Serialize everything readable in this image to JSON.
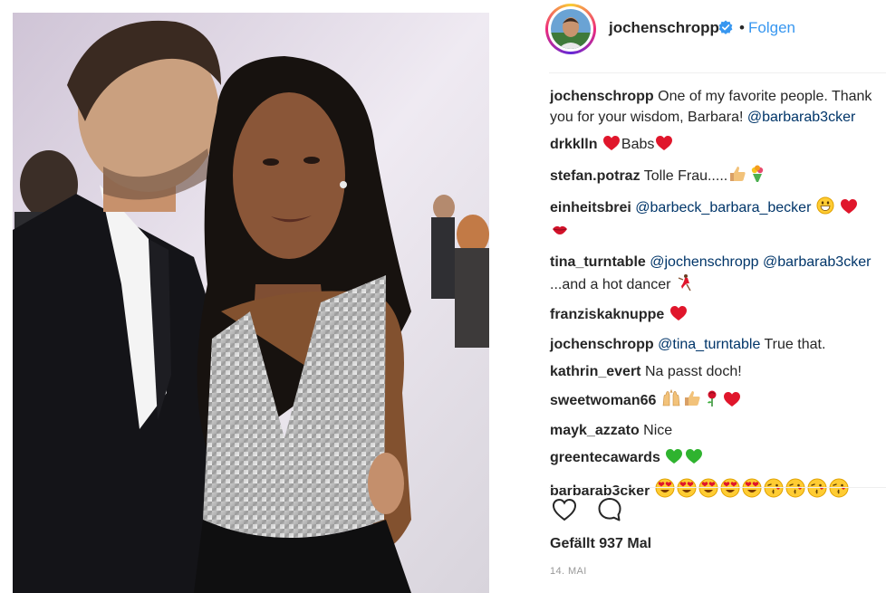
{
  "post": {
    "author": "jochenschropp",
    "separator": "•",
    "follow_label": "Folgen",
    "likes_text": "Gefällt 937 Mal",
    "date": "14. MAI"
  },
  "comments": [
    {
      "user": "jochenschropp",
      "parts": [
        {
          "t": "text",
          "v": " One of my favorite people. Thank you for your wisdom, Barbara! "
        },
        {
          "t": "mention",
          "v": "@barbarab3cker"
        }
      ]
    },
    {
      "user": "drkklln",
      "parts": [
        {
          "t": "text",
          "v": " "
        },
        {
          "t": "emoji",
          "v": "heart"
        },
        {
          "t": "text",
          "v": "Babs"
        },
        {
          "t": "emoji",
          "v": "heart"
        }
      ]
    },
    {
      "user": "stefan.potraz",
      "parts": [
        {
          "t": "text",
          "v": " Tolle Frau....."
        },
        {
          "t": "emoji",
          "v": "thumbs-up"
        },
        {
          "t": "emoji",
          "v": "bouquet"
        }
      ]
    },
    {
      "user": "einheitsbrei",
      "parts": [
        {
          "t": "text",
          "v": " "
        },
        {
          "t": "mention",
          "v": "@barbeck_barbara_becker"
        },
        {
          "t": "text",
          "v": " "
        },
        {
          "t": "emoji",
          "v": "grin"
        },
        {
          "t": "text",
          "v": " "
        },
        {
          "t": "emoji",
          "v": "heart"
        },
        {
          "t": "emoji",
          "v": "kiss"
        }
      ]
    },
    {
      "user": "tina_turntable",
      "parts": [
        {
          "t": "text",
          "v": " "
        },
        {
          "t": "mention",
          "v": "@jochenschropp"
        },
        {
          "t": "text",
          "v": " "
        },
        {
          "t": "mention",
          "v": "@barbarab3cker"
        },
        {
          "t": "text",
          "v": " ...and a hot dancer "
        },
        {
          "t": "emoji",
          "v": "dancer"
        }
      ]
    },
    {
      "user": "franziskaknuppe",
      "parts": [
        {
          "t": "text",
          "v": " "
        },
        {
          "t": "emoji",
          "v": "heart"
        }
      ]
    },
    {
      "user": "jochenschropp",
      "parts": [
        {
          "t": "text",
          "v": " "
        },
        {
          "t": "mention",
          "v": "@tina_turntable"
        },
        {
          "t": "text",
          "v": " True that."
        }
      ]
    },
    {
      "user": "kathrin_evert",
      "parts": [
        {
          "t": "text",
          "v": " Na passt doch!"
        }
      ]
    },
    {
      "user": "sweetwoman66",
      "parts": [
        {
          "t": "text",
          "v": " "
        },
        {
          "t": "emoji",
          "v": "raised-hands"
        },
        {
          "t": "emoji",
          "v": "thumbs-up"
        },
        {
          "t": "emoji",
          "v": "rose"
        },
        {
          "t": "emoji",
          "v": "heart"
        }
      ]
    },
    {
      "user": "mayk_azzato",
      "parts": [
        {
          "t": "text",
          "v": " Nice"
        }
      ]
    },
    {
      "user": "greentecawards",
      "parts": [
        {
          "t": "text",
          "v": " "
        },
        {
          "t": "emoji",
          "v": "green-heart"
        },
        {
          "t": "emoji",
          "v": "green-heart"
        }
      ]
    },
    {
      "user": "barbarab3cker",
      "parts": [
        {
          "t": "text",
          "v": " "
        },
        {
          "t": "emoji",
          "v": "heart-eyes"
        },
        {
          "t": "emoji",
          "v": "heart-eyes"
        },
        {
          "t": "emoji",
          "v": "heart-eyes"
        },
        {
          "t": "emoji",
          "v": "heart-eyes"
        },
        {
          "t": "emoji",
          "v": "heart-eyes"
        },
        {
          "t": "emoji",
          "v": "kissing-face"
        },
        {
          "t": "emoji",
          "v": "kissing-face"
        },
        {
          "t": "emoji",
          "v": "kissing-face"
        },
        {
          "t": "emoji",
          "v": "kissing-face"
        }
      ]
    }
  ],
  "icons": {
    "verified": "verified-badge-icon",
    "like": "heart-outline-icon",
    "comment": "speech-bubble-icon"
  },
  "colors": {
    "link": "#3897f0",
    "mention": "#003569",
    "text": "#262626",
    "muted": "#999999",
    "divider": "#efefef"
  }
}
